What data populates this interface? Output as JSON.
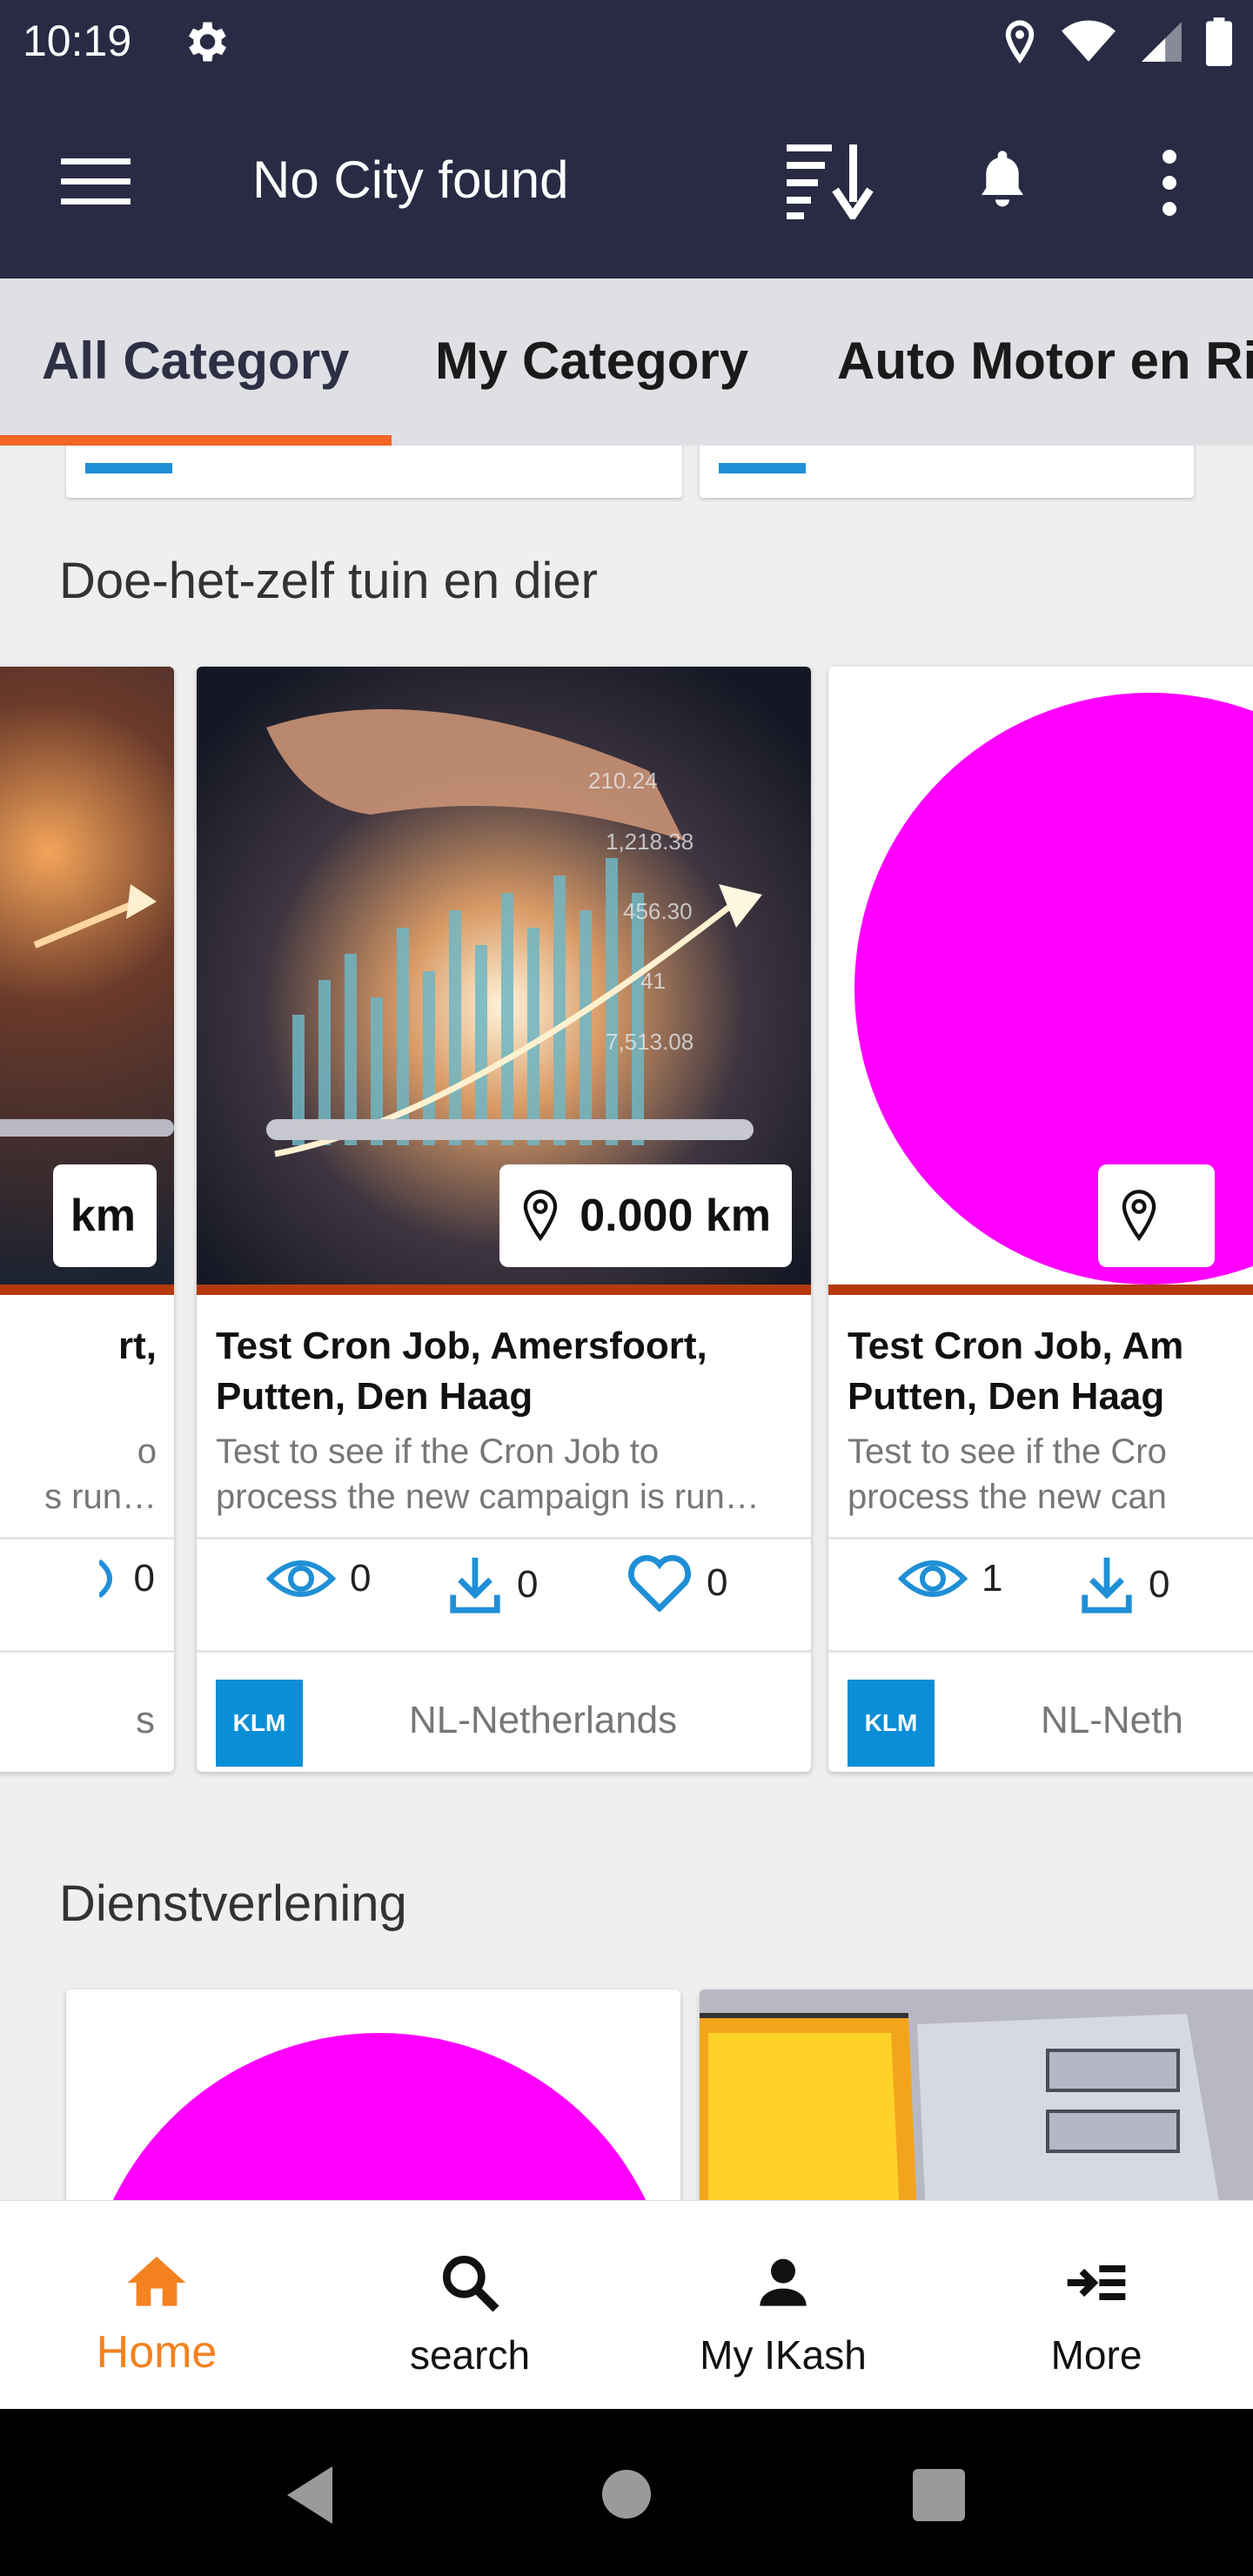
{
  "status_bar": {
    "time": "10:19"
  },
  "app_bar": {
    "city": "No City found"
  },
  "tabs": [
    {
      "label": "All Category"
    },
    {
      "label": "My Category"
    },
    {
      "label": "Auto Motor en Ri"
    }
  ],
  "sections": [
    {
      "title": "Doe-het-zelf tuin en dier",
      "cards": [
        {
          "distance": "km",
          "title_line1": "rt,",
          "desc_line1": "o",
          "desc_line2": "s run…",
          "likes": "0",
          "country": "s"
        },
        {
          "distance": "0.000 km",
          "title_line1": "Test Cron Job, Amersfoort,",
          "title_line2": "Putten, Den Haag",
          "desc_line1": "Test to see if the Cron Job to",
          "desc_line2": "process the new campaign is run…",
          "views": "0",
          "downloads": "0",
          "likes": "0",
          "brand": "KLM",
          "country": "NL-Netherlands"
        },
        {
          "title_line1": "Test Cron Job, Am",
          "title_line2": "Putten, Den Haag",
          "desc_line1": "Test to see if the Cro",
          "desc_line2": "process the new can",
          "views": "1",
          "downloads": "0",
          "brand": "KLM",
          "country": "NL-Neth"
        }
      ]
    },
    {
      "title": "Dienstverlening"
    }
  ],
  "bottom_nav": [
    {
      "label": "Home",
      "icon": "home-icon"
    },
    {
      "label": "search",
      "icon": "search-icon"
    },
    {
      "label": "My IKash",
      "icon": "person-icon"
    },
    {
      "label": "More",
      "icon": "more-list-icon"
    }
  ],
  "colors": {
    "header": "#292b44",
    "tab_indicator": "#f26522",
    "accent_orange": "#f4821f",
    "icon_blue": "#1f8fd6",
    "image_rule": "#b53a10",
    "klm_blue": "#0a8fd6"
  }
}
